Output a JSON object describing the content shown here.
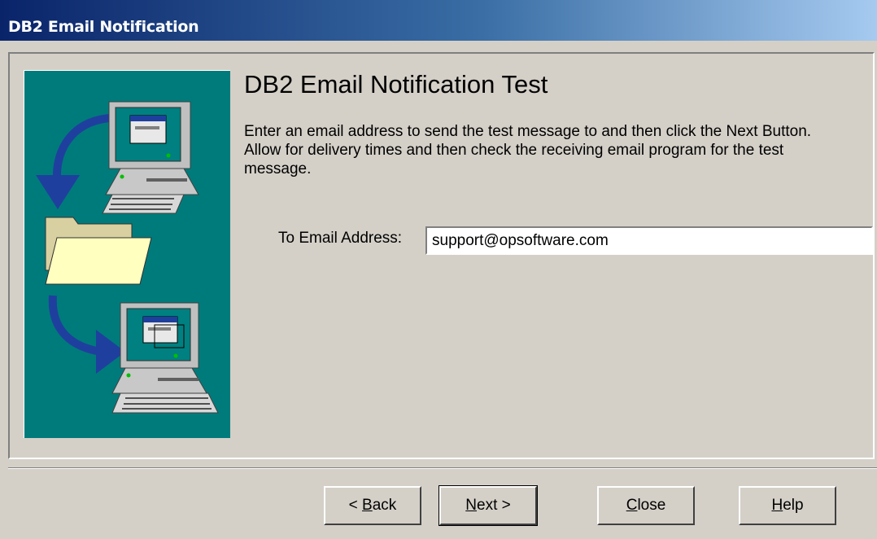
{
  "window": {
    "title": "DB2 Email Notification"
  },
  "page": {
    "heading": "DB2 Email Notification Test",
    "description": "Enter an email address to send the test message to and then click the Next Button. Allow for delivery times and then check the receiving email program for the test message."
  },
  "form": {
    "email_label": "To Email Address:",
    "email_value": "support@opsoftware.com"
  },
  "buttons": {
    "back": {
      "prefix": "< ",
      "mnemonic": "B",
      "rest": "ack"
    },
    "next": {
      "mnemonic": "N",
      "rest": "ext >"
    },
    "close": {
      "mnemonic": "C",
      "rest": "lose"
    },
    "help": {
      "mnemonic": "H",
      "rest": "elp"
    }
  },
  "illustration": {
    "icons": [
      "computer-icon",
      "arrow-icon",
      "folder-icon"
    ]
  },
  "colors": {
    "panel": "#007b7b",
    "titlebar_start": "#0a246a",
    "titlebar_end": "#a6caf0",
    "face": "#d4d0c8"
  }
}
